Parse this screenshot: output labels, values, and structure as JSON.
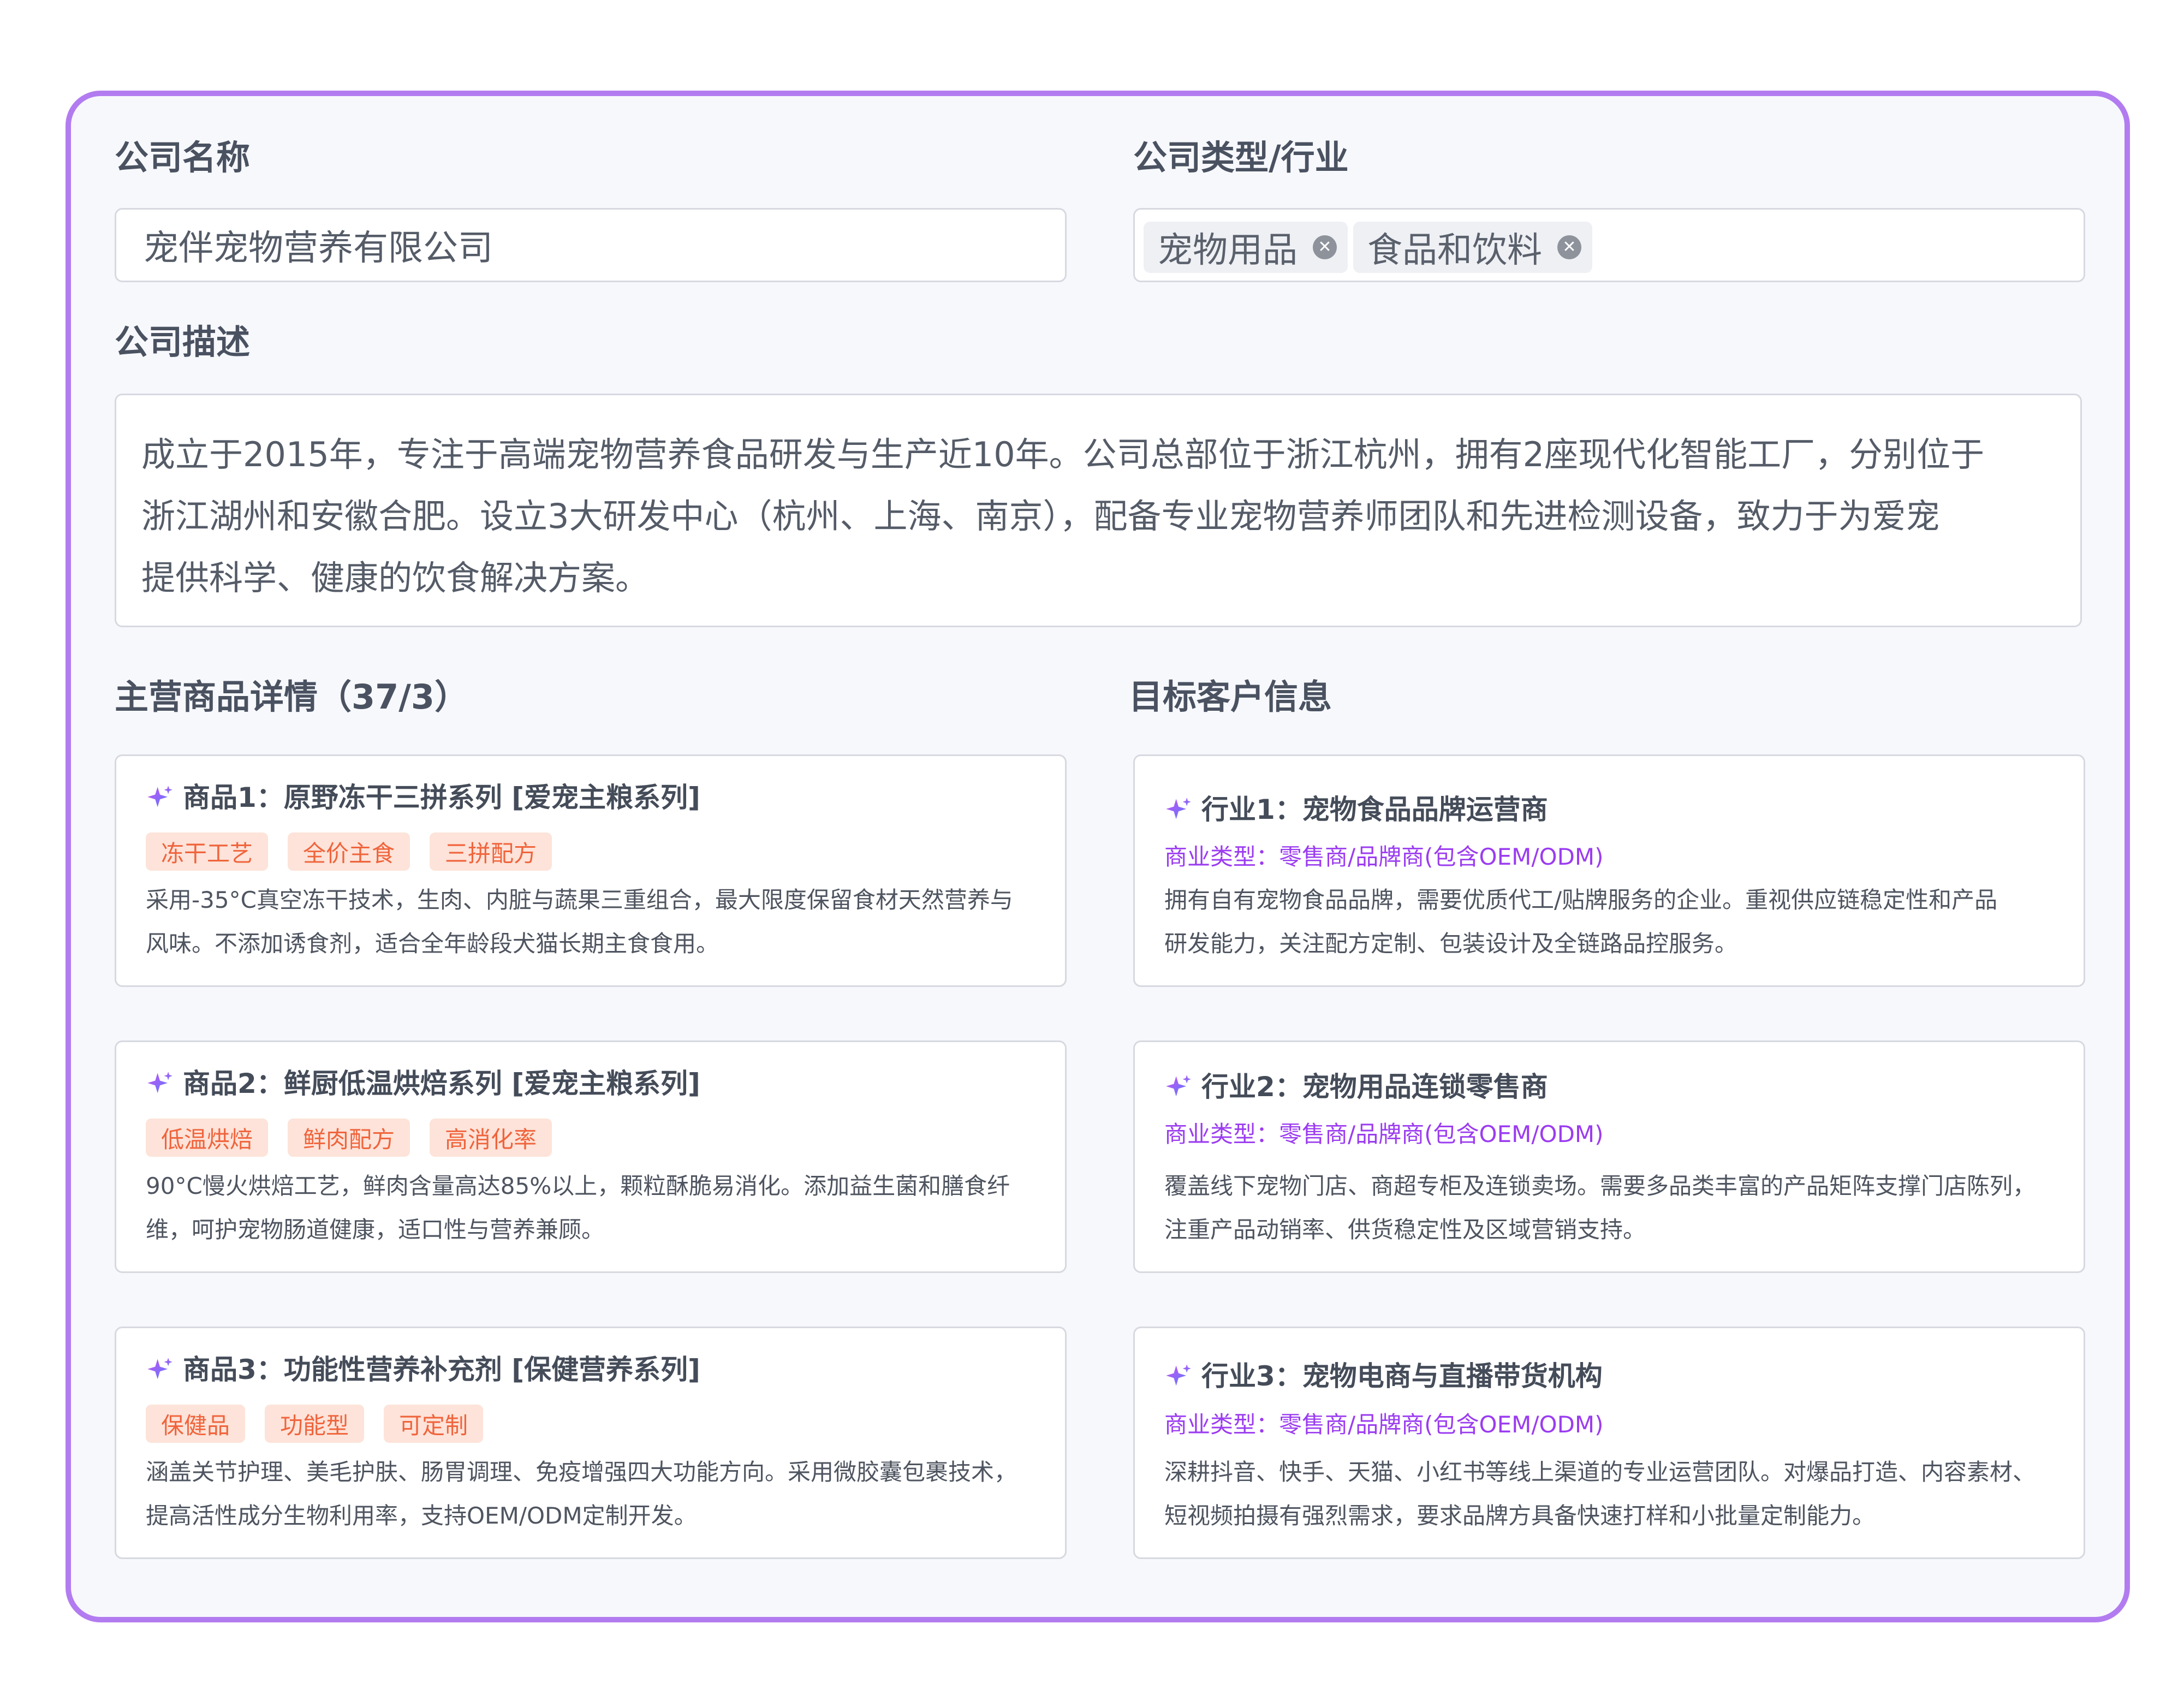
{
  "company_name": {
    "label": "公司名称",
    "value": "宠伴宠物营养有限公司"
  },
  "company_type": {
    "label": "公司类型/行业",
    "chips": [
      "宠物用品",
      "食品和饮料"
    ]
  },
  "company_description": {
    "label": "公司描述",
    "lines": [
      "成立于2015年，专注于高端宠物营养食品研发与生产近10年。公司总部位于浙江杭州，拥有2座现代化智能工厂，分别位于",
      "浙江湖州和安徽合肥。设立3大研发中心（杭州、上海、南京），配备专业宠物营养师团队和先进检测设备，致力于为爱宠",
      "提供科学、健康的饮食解决方案。"
    ]
  },
  "products": {
    "label": "主营商品详情（37/3）",
    "items": [
      {
        "title": "商品1：原野冻干三拼系列 [爱宠主粮系列]",
        "tags": [
          "冻干工艺",
          "全价主食",
          "三拼配方"
        ],
        "lines": [
          "采用-35°C真空冻干技术，生肉、内脏与蔬果三重组合，最大限度保留食材天然营养与",
          "风味。不添加诱食剂，适合全年龄段犬猫长期主食食用。"
        ]
      },
      {
        "title": "商品2：鲜厨低温烘焙系列 [爱宠主粮系列]",
        "tags": [
          "低温烘焙",
          "鲜肉配方",
          "高消化率"
        ],
        "lines": [
          "90°C慢火烘焙工艺，鲜肉含量高达85%以上，颗粒酥脆易消化。添加益生菌和膳食纤",
          "维，呵护宠物肠道健康，适口性与营养兼顾。"
        ]
      },
      {
        "title": "商品3：功能性营养补充剂 [保健营养系列]",
        "tags": [
          "保健品",
          "功能型",
          "可定制"
        ],
        "lines": [
          "涵盖关节护理、美毛护肤、肠胃调理、免疫增强四大功能方向。采用微胶囊包裹技术，",
          "提高活性成分生物利用率，支持OEM/ODM定制开发。"
        ]
      }
    ]
  },
  "customers": {
    "label": "目标客户信息",
    "items": [
      {
        "title": "行业1：宠物食品品牌运营商",
        "biz_type": "商业类型：零售商/品牌商(包含OEM/ODM)",
        "lines": [
          "拥有自有宠物食品品牌，需要优质代工/贴牌服务的企业。重视供应链稳定性和产品",
          "研发能力，关注配方定制、包装设计及全链路品控服务。"
        ]
      },
      {
        "title": "行业2：宠物用品连锁零售商",
        "biz_type": "商业类型：零售商/品牌商(包含OEM/ODM)",
        "lines": [
          "覆盖线下宠物门店、商超专柜及连锁卖场。需要多品类丰富的产品矩阵支撑门店陈列，",
          "注重产品动销率、供货稳定性及区域营销支持。"
        ]
      },
      {
        "title": "行业3：宠物电商与直播带货机构",
        "biz_type": "商业类型：零售商/品牌商(包含OEM/ODM)",
        "lines": [
          "深耕抖音、快手、天猫、小红书等线上渠道的专业运营团队。对爆品打造、内容素材、",
          "短视频拍摄有强烈需求，要求品牌方具备快速打样和小批量定制能力。"
        ]
      }
    ]
  },
  "icons": {
    "sparkle": "sparkle-icon",
    "chip_remove": "close-circle-icon"
  },
  "colors": {
    "panel_border": "#b27cf0",
    "panel_bg": "#f7f8fc",
    "tag_bg": "#fde3d9",
    "tag_text": "#f0643c",
    "biz_type_text": "#9b3cf0",
    "sparkle_gradient": [
      "#c850f0",
      "#5b7cff"
    ]
  }
}
